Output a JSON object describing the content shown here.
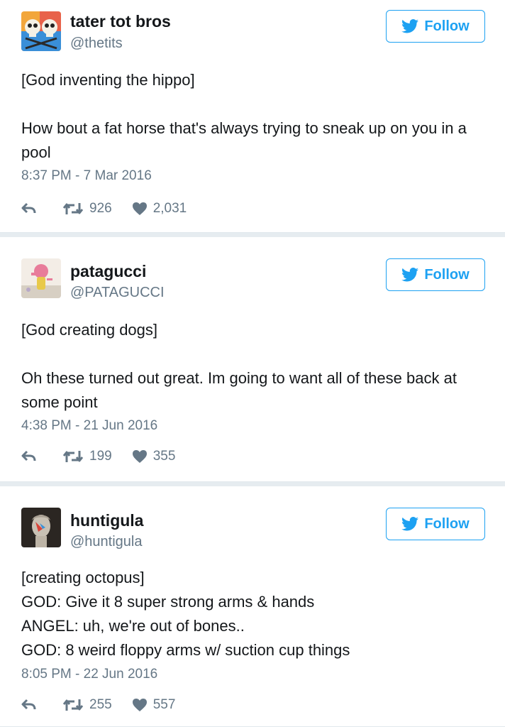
{
  "tweets": [
    {
      "name": "tater tot bros",
      "handle": "@thetits",
      "follow_label": "Follow",
      "text": "[God inventing the hippo]\n\nHow bout a fat horse that's always trying to sneak up on you in a pool",
      "timestamp": "8:37 PM - 7 Mar 2016",
      "retweets": "926",
      "likes": "2,031",
      "avatar_icon": "skulls-avatar"
    },
    {
      "name": "patagucci",
      "handle": "@PATAGUCCI",
      "follow_label": "Follow",
      "text": "[God creating dogs]\n\nOh these turned out great. Im going to want all of these back at some point",
      "timestamp": "4:38 PM - 21 Jun 2016",
      "retweets": "199",
      "likes": "355",
      "avatar_icon": "cartoon-avatar"
    },
    {
      "name": "huntigula",
      "handle": "@huntigula",
      "follow_label": "Follow",
      "text": "[creating octopus]\nGOD: Give it 8 super strong arms & hands\nANGEL: uh, we're out of bones..\nGOD: 8 weird floppy arms w/ suction cup things",
      "timestamp": "8:05 PM - 22 Jun 2016",
      "retweets": "255",
      "likes": "557",
      "avatar_icon": "statue-avatar"
    }
  ],
  "colors": {
    "brand": "#1da1f2",
    "text": "#14171a",
    "muted": "#657786"
  }
}
